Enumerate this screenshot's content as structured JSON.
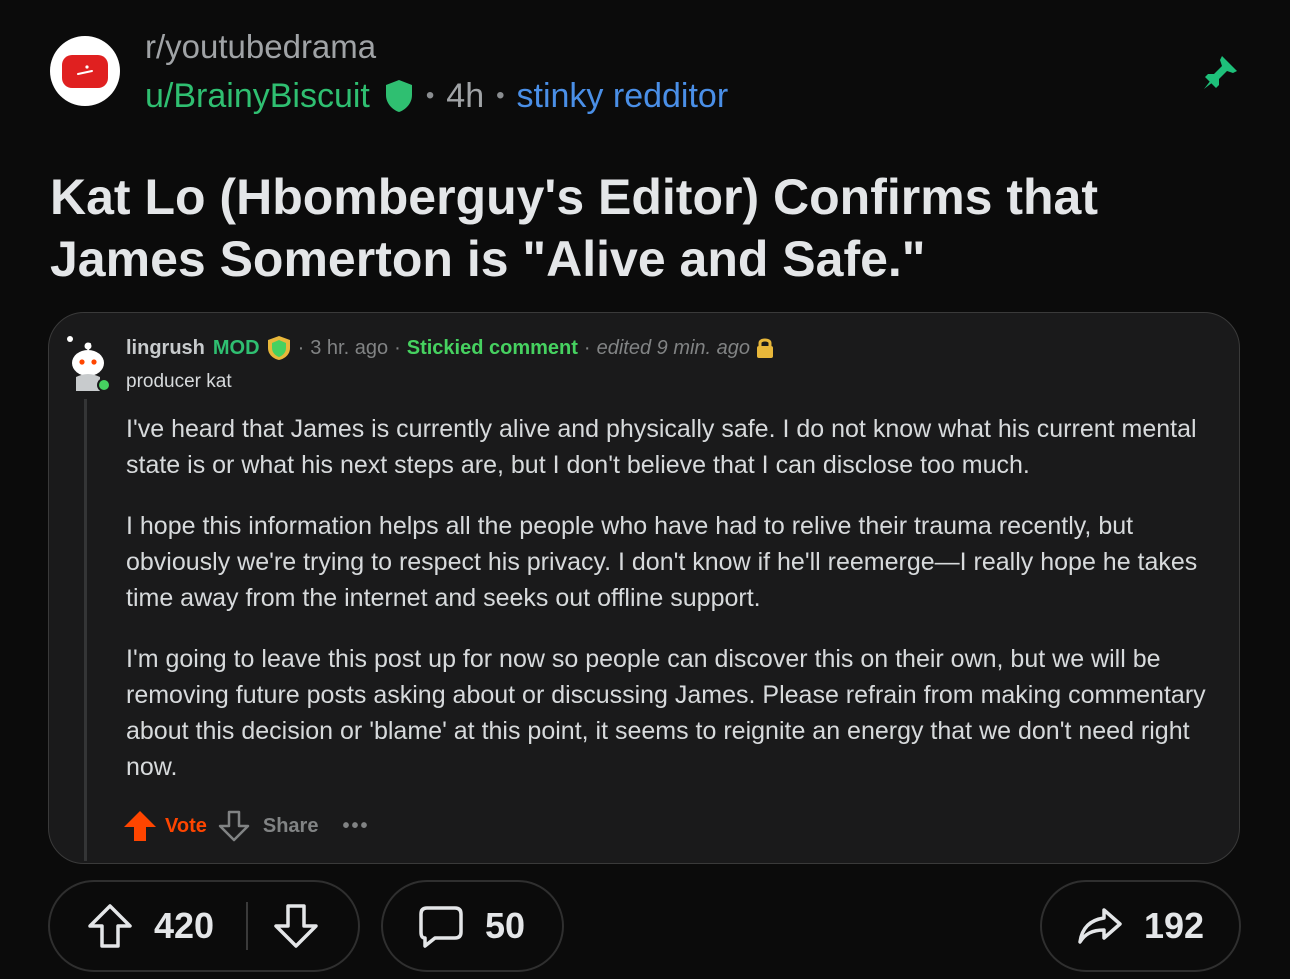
{
  "post": {
    "subreddit": "r/youtubedrama",
    "author": "u/BrainyBiscuit",
    "age": "4h",
    "flair": "stinky redditor",
    "title": "Kat Lo (Hbomberguy's Editor) Confirms that James Somerton is \"Alive and Safe.\"",
    "upvotes": "420",
    "comments": "50",
    "shares": "192"
  },
  "comment": {
    "username": "lingrush",
    "mod_badge": "MOD",
    "time": "3 hr. ago",
    "stickied": "Stickied comment",
    "edited": "edited 9 min. ago",
    "user_flair": "producer kat",
    "paragraphs": [
      "I've heard that James is currently alive and physically safe. I do not know what his current mental state is or what his next steps are, but I don't believe that I can disclose too much.",
      "I hope this information helps all the people who have had to relive their trauma recently, but obviously we're trying to respect his privacy. I don't know if he'll reemerge—I really hope he takes time away from the internet and seeks out offline support.",
      "I'm going to leave this post up for now so people can discover this on their own, but we will be removing future posts asking about or discussing James. Please refrain from making commentary about this decision or 'blame' at this point, it seems to reignite an energy that we don't need right now."
    ],
    "vote_label": "Vote",
    "share_label": "Share",
    "more_label": "•••"
  },
  "colors": {
    "background": "#0b0b0b",
    "username_green": "#2fbf71",
    "flair_blue": "#4a8fe7",
    "upvote_orange": "#ff4500",
    "pin_green": "#1ec07a"
  },
  "icons": [
    "youtube-logo-icon",
    "verified-shield-icon",
    "pin-icon",
    "snoo-avatar-icon",
    "mod-shield-icon",
    "lock-icon",
    "upvote-arrow-icon",
    "downvote-arrow-icon",
    "comment-bubble-icon",
    "share-arrow-icon"
  ]
}
